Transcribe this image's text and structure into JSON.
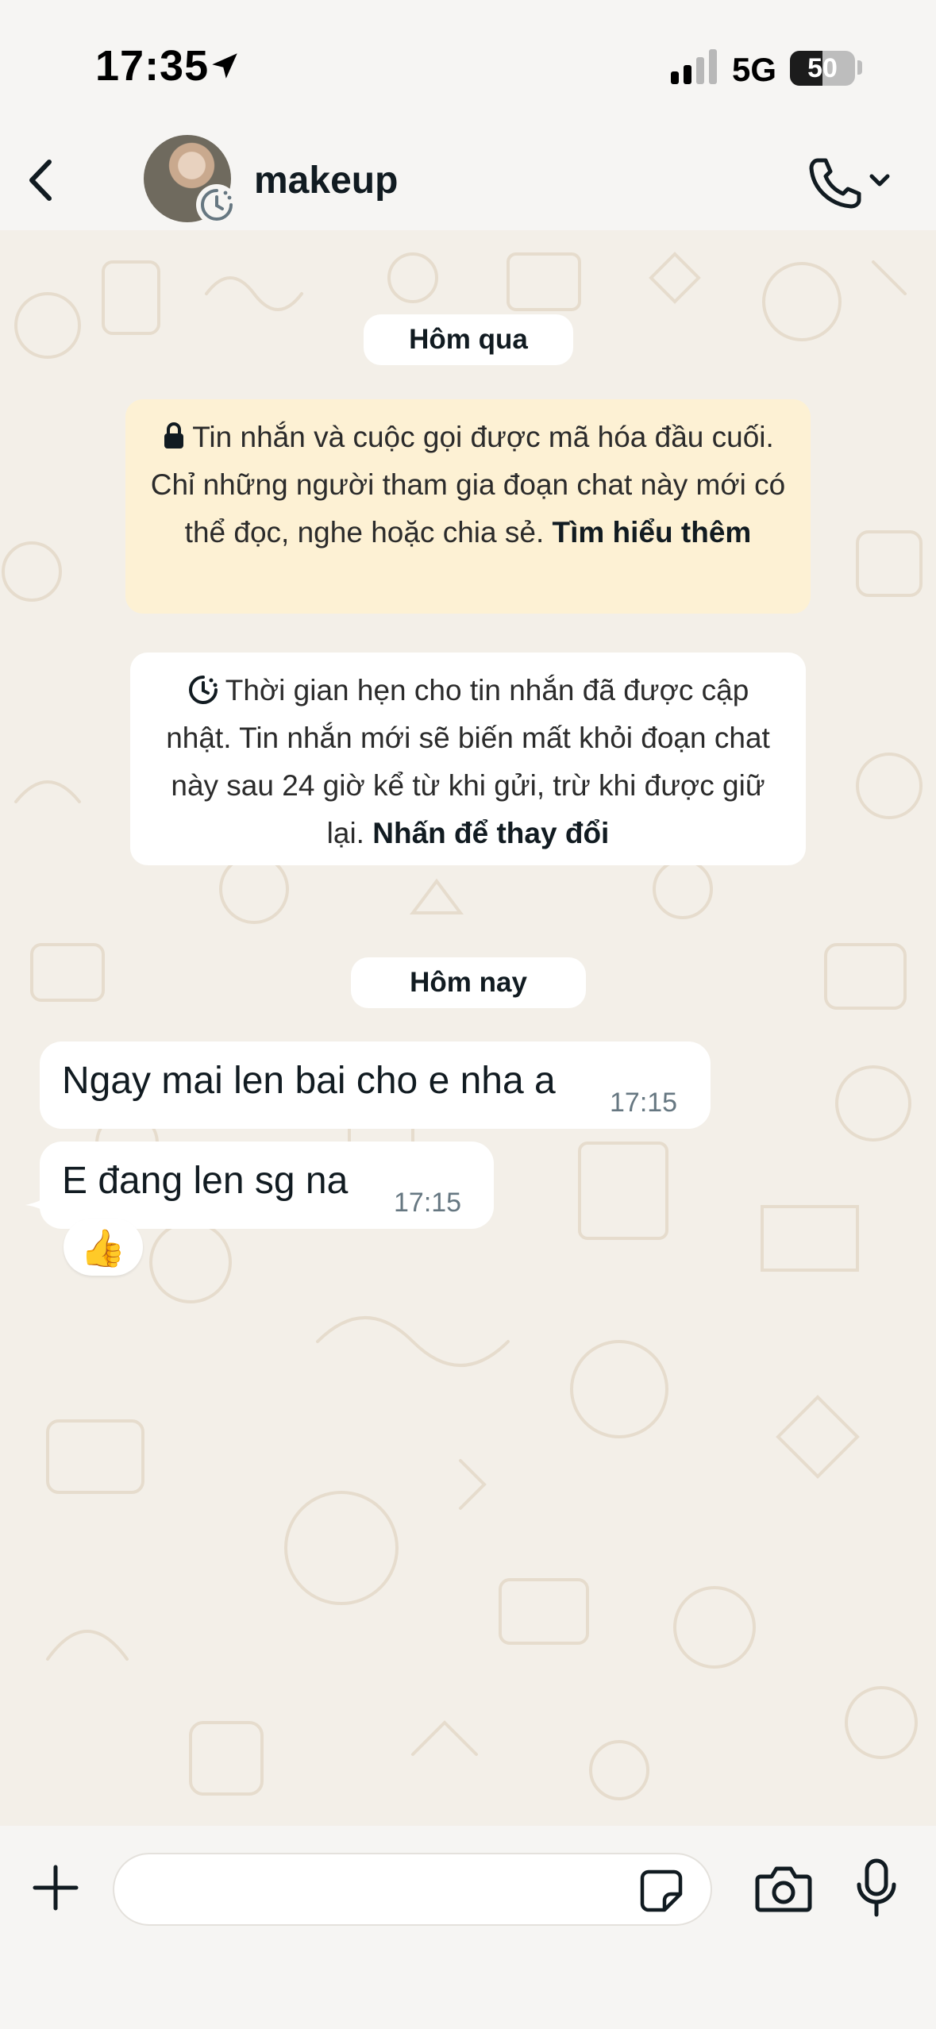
{
  "status_bar": {
    "time": "17:35",
    "network": "5G",
    "battery_level": "50",
    "battery_fraction": 0.5
  },
  "header": {
    "contact_name": "makeup"
  },
  "chat": {
    "date_yesterday": "Hôm qua",
    "encryption_notice": "Tin nhắn và cuộc gọi được mã hóa đầu cuối. Chỉ những người tham gia đoạn chat này mới có thể đọc, nghe hoặc chia sẻ.",
    "encryption_link": "Tìm hiểu thêm",
    "timer_notice": "Thời gian hẹn cho tin nhắn đã được cập nhật. Tin nhắn mới sẽ biến mất khỏi đoạn chat này sau 24 giờ kể từ khi gửi, trừ khi được giữ lại.",
    "timer_link": "Nhấn để thay đổi",
    "date_today": "Hôm nay",
    "messages": [
      {
        "text": "Ngay mai len bai cho e nha a",
        "time": "17:15"
      },
      {
        "text": "E đang len sg na",
        "time": "17:15"
      }
    ],
    "reaction": "👍"
  },
  "composer": {
    "placeholder": ""
  },
  "icons": {
    "back": "chevron-left-icon",
    "call": "phone-icon",
    "dropdown": "chevron-down-icon",
    "lock": "lock-icon",
    "timer": "disappearing-timer-icon",
    "plus": "plus-icon",
    "sticker": "sticker-icon",
    "camera": "camera-icon",
    "mic": "microphone-icon"
  },
  "colors": {
    "wallpaper": "#f3efe8",
    "bubble": "#ffffff",
    "encryption_bg": "#fdf1d4",
    "timestamp": "#667781"
  }
}
